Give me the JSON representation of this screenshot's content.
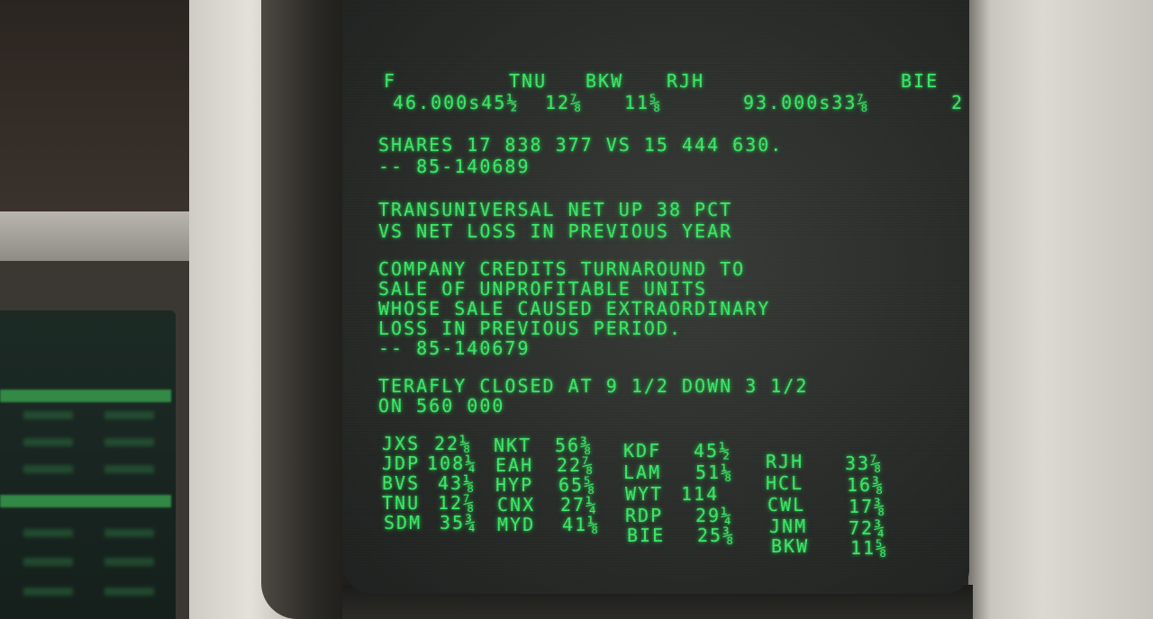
{
  "header": {
    "symbols": [
      "F",
      "TNU",
      "BKW",
      "RJH",
      "BIE"
    ],
    "quotes": [
      "46.000s45½",
      "12⅞",
      "11⅝",
      "93.000s33⅞",
      "2"
    ]
  },
  "news": [
    {
      "lines": [
        "SHARES 17 838 377 VS 15 444 630.",
        "-- 85-140689"
      ]
    },
    {
      "lines": [
        "TRANSUNIVERSAL NET UP 38 PCT",
        "VS NET LOSS IN PREVIOUS YEAR"
      ]
    },
    {
      "lines": [
        "COMPANY CREDITS TURNAROUND TO",
        "SALE OF UNPROFITABLE UNITS",
        "WHOSE SALE CAUSED EXTRAORDINARY",
        "LOSS IN PREVIOUS PERIOD.",
        "-- 85-140679"
      ]
    },
    {
      "lines": [
        "TERAFLY CLOSED AT 9 1/2 DOWN 3 1/2",
        "ON 560 000"
      ]
    }
  ],
  "ticker": [
    [
      [
        "JXS",
        "22⅛"
      ],
      [
        "JDP",
        "108¼"
      ],
      [
        "BVS",
        "43⅛"
      ],
      [
        "TNU",
        "12⅞"
      ],
      [
        "SDM",
        "35¾"
      ]
    ],
    [
      [
        "NKT",
        "56⅜"
      ],
      [
        "EAH",
        "22⅞"
      ],
      [
        "HYP",
        "65⅝"
      ],
      [
        "CNX",
        "27¼"
      ],
      [
        "MYD",
        "41⅛"
      ]
    ],
    [
      [
        "KDF",
        "45½"
      ],
      [
        "LAM",
        "51⅛"
      ],
      [
        "WYT",
        "114"
      ],
      [
        "RDP",
        "29¼"
      ],
      [
        "BIE",
        "25⅜"
      ]
    ],
    [
      [
        "RJH",
        "33⅞"
      ],
      [
        "HCL",
        "16⅜"
      ],
      [
        "CWL",
        "17⅜"
      ],
      [
        "JNM",
        "72¾"
      ],
      [
        "BKW",
        "11⅝"
      ]
    ]
  ]
}
